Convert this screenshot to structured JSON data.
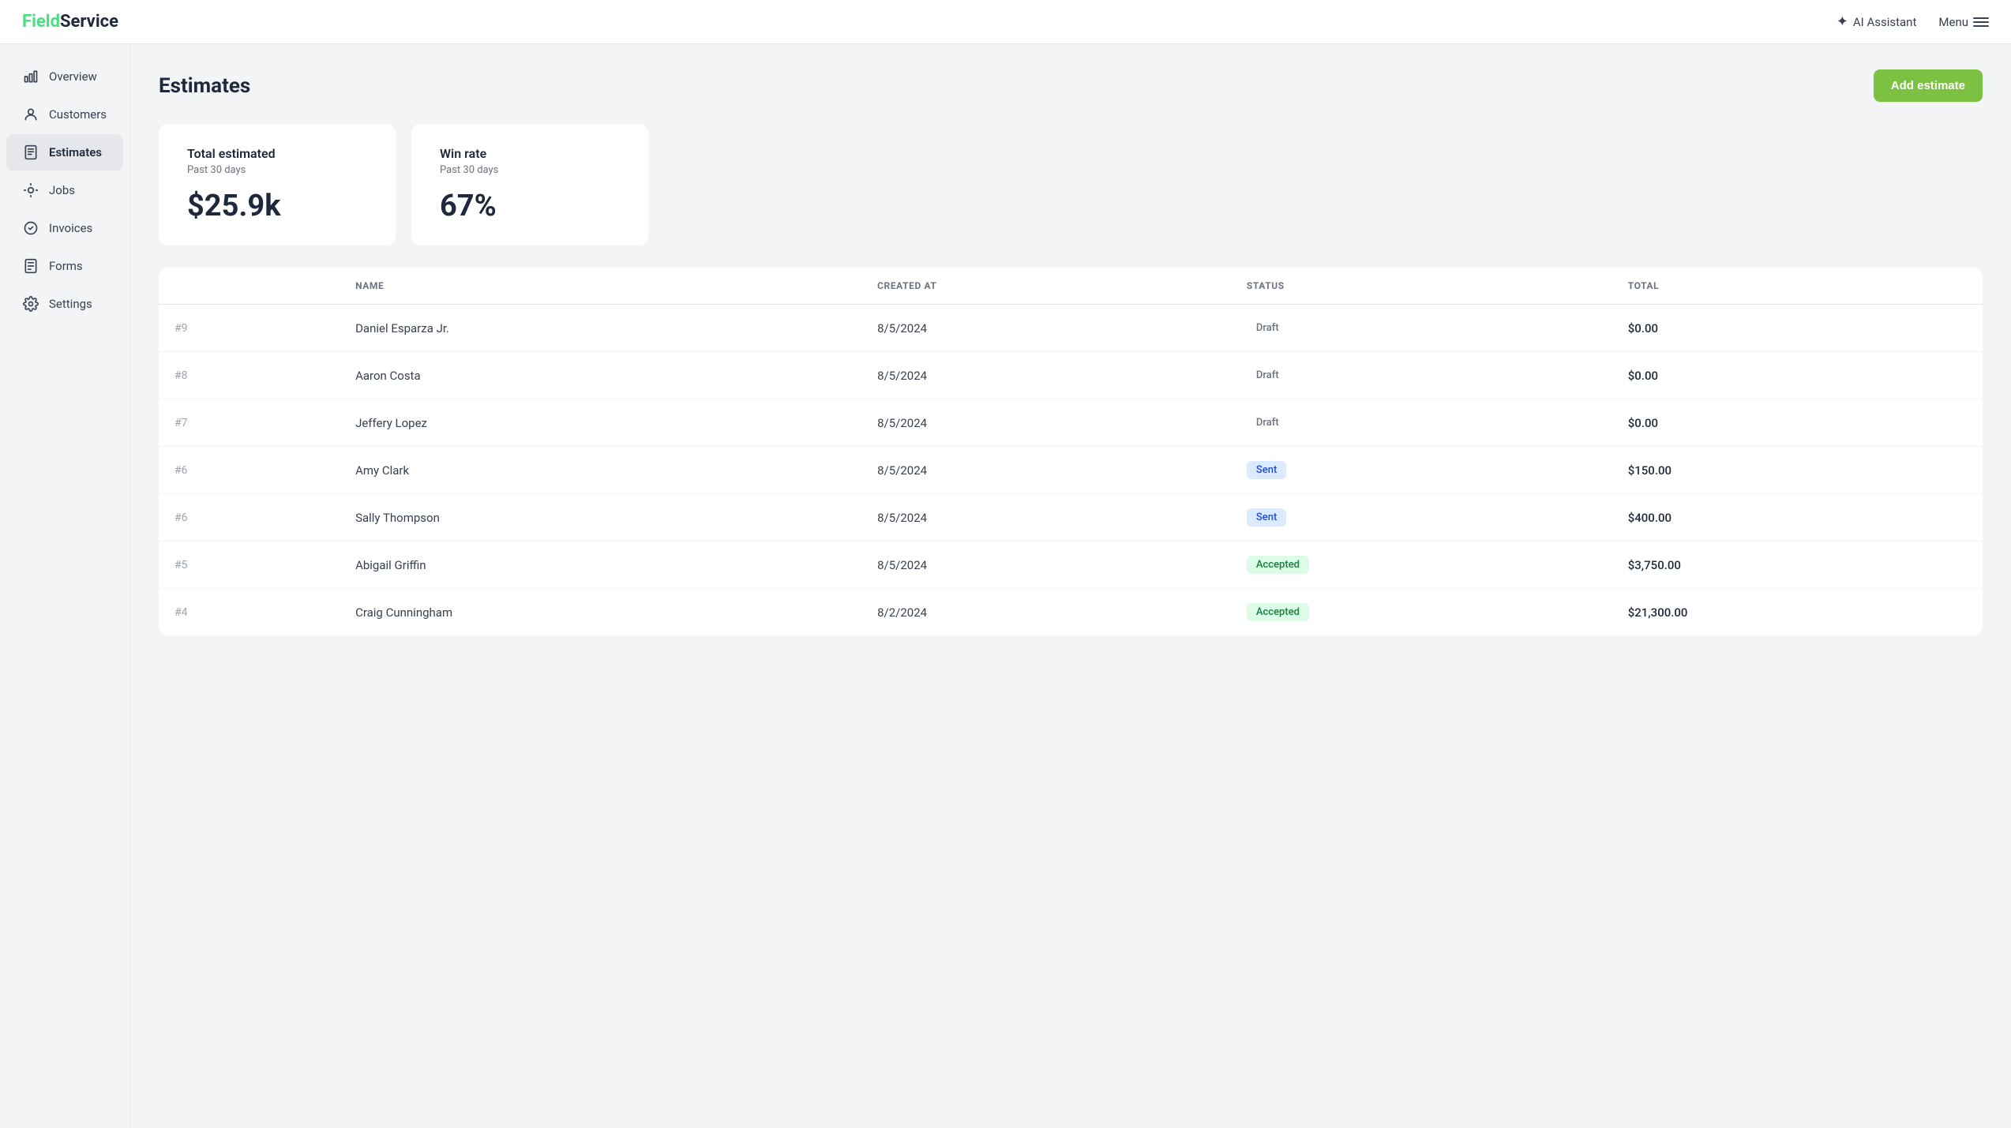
{
  "brand": {
    "field": "Field",
    "service": "Service"
  },
  "topnav": {
    "ai_assistant_label": "AI Assistant",
    "menu_label": "Menu"
  },
  "sidebar": {
    "items": [
      {
        "id": "overview",
        "label": "Overview",
        "active": false
      },
      {
        "id": "customers",
        "label": "Customers",
        "active": false
      },
      {
        "id": "estimates",
        "label": "Estimates",
        "active": true
      },
      {
        "id": "jobs",
        "label": "Jobs",
        "active": false
      },
      {
        "id": "invoices",
        "label": "Invoices",
        "active": false
      },
      {
        "id": "forms",
        "label": "Forms",
        "active": false
      },
      {
        "id": "settings",
        "label": "Settings",
        "active": false
      }
    ]
  },
  "page": {
    "title": "Estimates",
    "add_button_label": "Add estimate"
  },
  "stats": [
    {
      "title": "Total estimated",
      "subtitle": "Past 30 days",
      "value": "$25.9k"
    },
    {
      "title": "Win rate",
      "subtitle": "Past 30 days",
      "value": "67%"
    }
  ],
  "table": {
    "columns": [
      "",
      "NAME",
      "CREATED AT",
      "STATUS",
      "TOTAL"
    ],
    "rows": [
      {
        "num": "#9",
        "name": "Daniel Esparza Jr.",
        "created_at": "8/5/2024",
        "status": "Draft",
        "status_type": "draft",
        "total": "$0.00"
      },
      {
        "num": "#8",
        "name": "Aaron Costa",
        "created_at": "8/5/2024",
        "status": "Draft",
        "status_type": "draft",
        "total": "$0.00"
      },
      {
        "num": "#7",
        "name": "Jeffery Lopez",
        "created_at": "8/5/2024",
        "status": "Draft",
        "status_type": "draft",
        "total": "$0.00"
      },
      {
        "num": "#6",
        "name": "Amy Clark",
        "created_at": "8/5/2024",
        "status": "Sent",
        "status_type": "sent",
        "total": "$150.00"
      },
      {
        "num": "#6",
        "name": "Sally Thompson",
        "created_at": "8/5/2024",
        "status": "Sent",
        "status_type": "sent",
        "total": "$400.00"
      },
      {
        "num": "#5",
        "name": "Abigail Griffin",
        "created_at": "8/5/2024",
        "status": "Accepted",
        "status_type": "accepted",
        "total": "$3,750.00"
      },
      {
        "num": "#4",
        "name": "Craig Cunningham",
        "created_at": "8/2/2024",
        "status": "Accepted",
        "status_type": "accepted",
        "total": "$21,300.00"
      }
    ]
  }
}
